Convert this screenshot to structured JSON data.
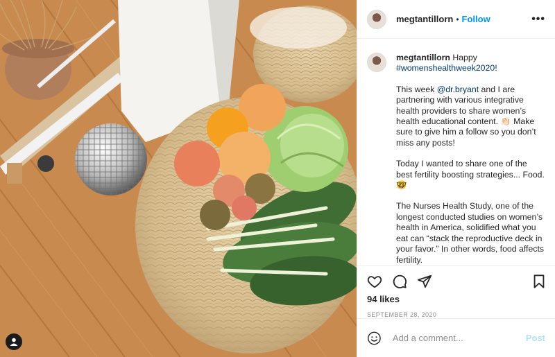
{
  "header": {
    "username": "megtantillorn",
    "separator": "•",
    "follow_label": "Follow",
    "more_label": "•••"
  },
  "caption": {
    "username": "megtantillorn",
    "p1_text": "Happy",
    "p1_hashtag": "#womenshealthweek2020!",
    "p2_before": "This week",
    "p2_mention": "@dr.bryant",
    "p2_after": "and I are partnering with various integrative health providers to share women’s health educational content. 👏🏻 Make sure to give him a follow so you don’t miss any posts!",
    "p3": "Today I wanted to share one of the best fertility boosting strategies... Food. 🤓",
    "p4": "The Nurses Health Study, one of the longest conducted studies on women’s health in America, solidified what you eat can “stack the reproductive deck in your favor.” In other words, food affects fertility."
  },
  "actions": {
    "like_icon": "heart-icon",
    "comment_icon": "comment-icon",
    "share_icon": "paper-plane-icon",
    "save_icon": "bookmark-icon"
  },
  "likes": "94 likes",
  "date": "SEPTEMBER 28, 2020",
  "comment": {
    "placeholder": "Add a comment...",
    "post_label": "Post",
    "emoji_icon": "smiley-icon"
  },
  "colors": {
    "accent": "#0095f6",
    "post_disabled": "#b2dffc",
    "link": "#00376b",
    "muted": "#8e8e8e"
  }
}
